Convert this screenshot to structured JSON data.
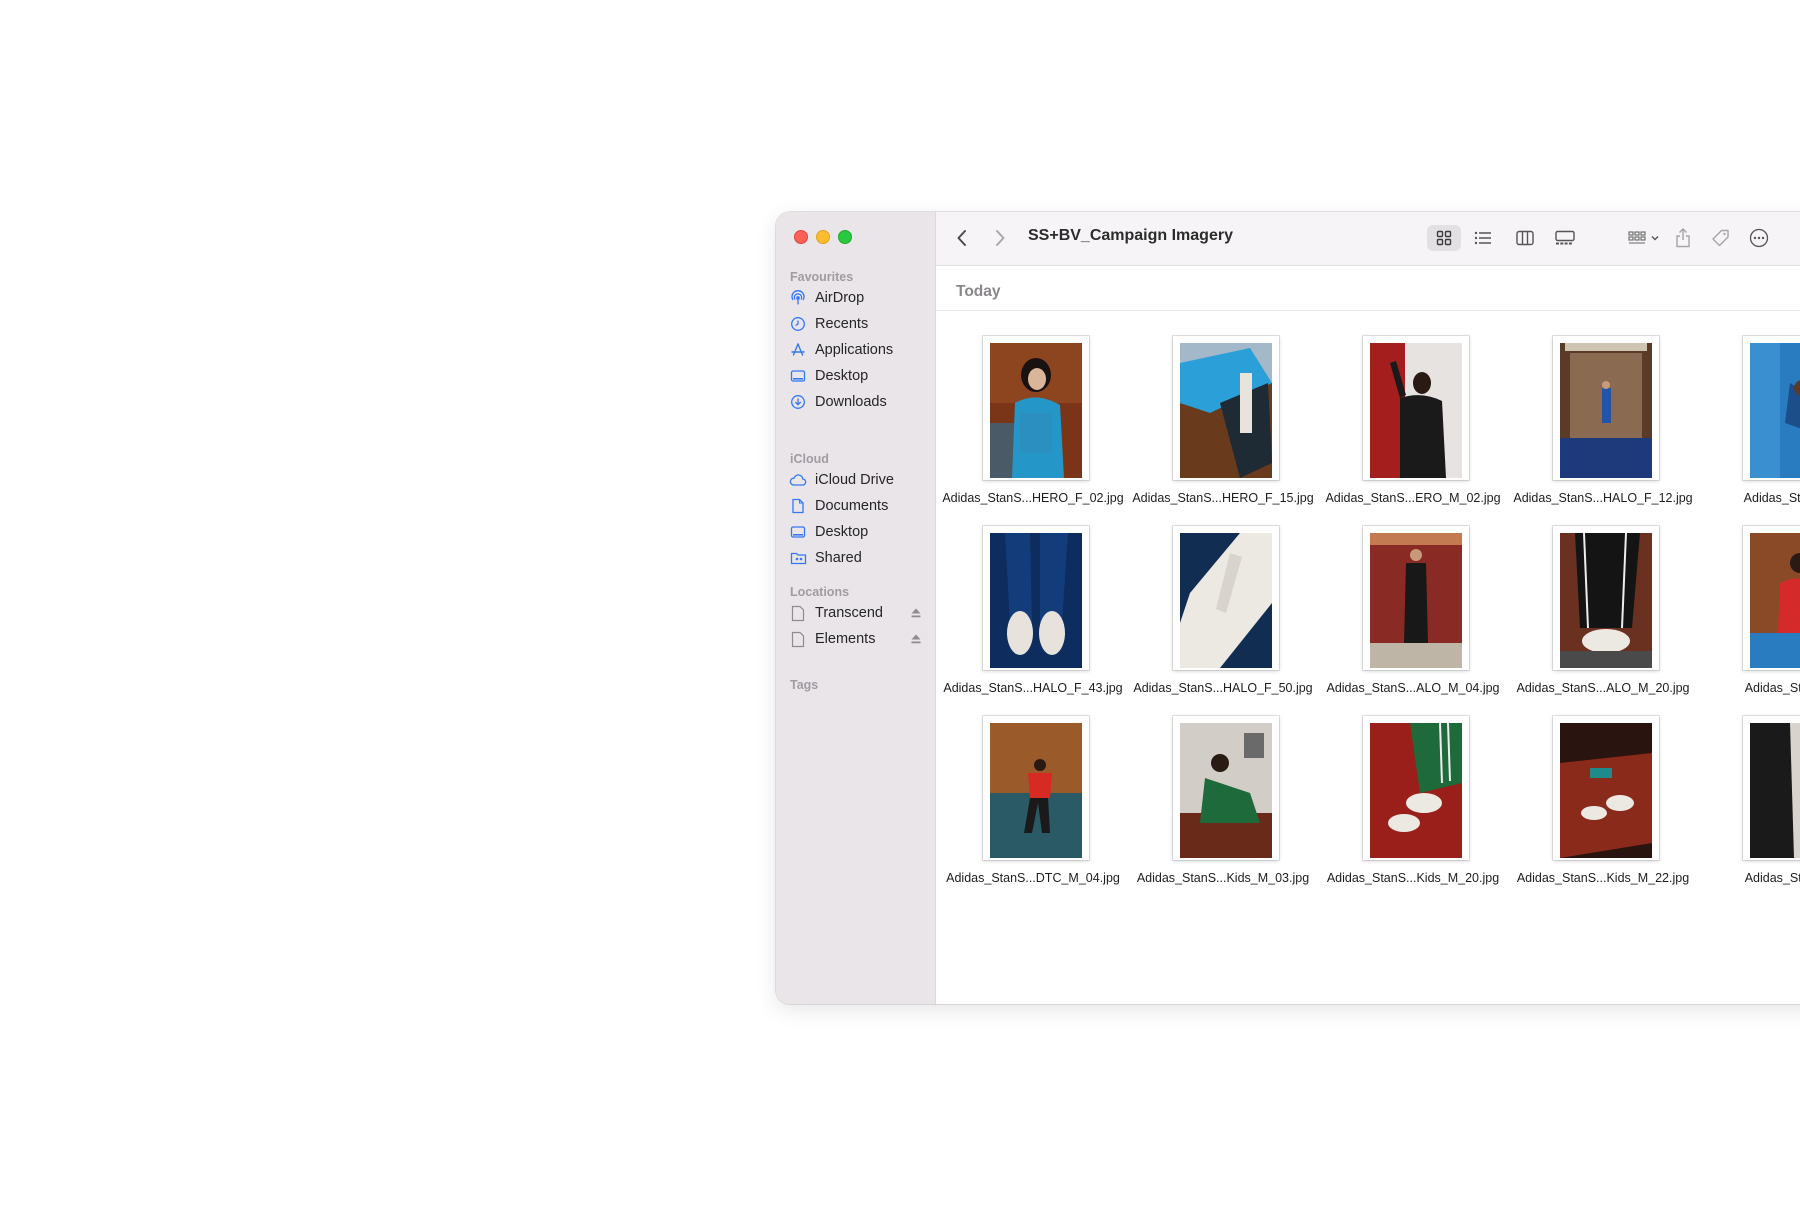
{
  "window": {
    "title": "SS+BV_Campaign Imagery",
    "section_heading": "Today"
  },
  "sidebar": {
    "favourites_label": "Favourites",
    "favourites": [
      {
        "label": "AirDrop",
        "icon": "airdrop-icon"
      },
      {
        "label": "Recents",
        "icon": "clock-icon"
      },
      {
        "label": "Applications",
        "icon": "applications-icon"
      },
      {
        "label": "Desktop",
        "icon": "desktop-icon"
      },
      {
        "label": "Downloads",
        "icon": "download-icon"
      }
    ],
    "icloud_label": "iCloud",
    "icloud": [
      {
        "label": "iCloud Drive",
        "icon": "cloud-icon"
      },
      {
        "label": "Documents",
        "icon": "document-icon"
      },
      {
        "label": "Desktop",
        "icon": "desktop-icon"
      },
      {
        "label": "Shared",
        "icon": "shared-folder-icon"
      }
    ],
    "locations_label": "Locations",
    "locations": [
      {
        "label": "Transcend",
        "icon": "drive-icon"
      },
      {
        "label": "Elements",
        "icon": "drive-icon"
      }
    ],
    "tags_label": "Tags"
  },
  "files": [
    {
      "name": "Adidas_StanS...HERO_F_02.jpg"
    },
    {
      "name": "Adidas_StanS...HERO_F_15.jpg"
    },
    {
      "name": "Adidas_StanS...ERO_M_02.jpg"
    },
    {
      "name": "Adidas_StanS...HALO_F_12.jpg"
    },
    {
      "name": "Adidas_StanS...H"
    },
    {
      "name": "Adidas_StanS...HALO_F_43.jpg"
    },
    {
      "name": "Adidas_StanS...HALO_F_50.jpg"
    },
    {
      "name": "Adidas_StanS...ALO_M_04.jpg"
    },
    {
      "name": "Adidas_StanS...ALO_M_20.jpg"
    },
    {
      "name": "Adidas_StanS..._"
    },
    {
      "name": "Adidas_StanS...DTC_M_04.jpg"
    },
    {
      "name": "Adidas_StanS...Kids_M_03.jpg"
    },
    {
      "name": "Adidas_StanS...Kids_M_20.jpg"
    },
    {
      "name": "Adidas_StanS...Kids_M_22.jpg"
    },
    {
      "name": "Adidas_StanS..._"
    }
  ]
}
